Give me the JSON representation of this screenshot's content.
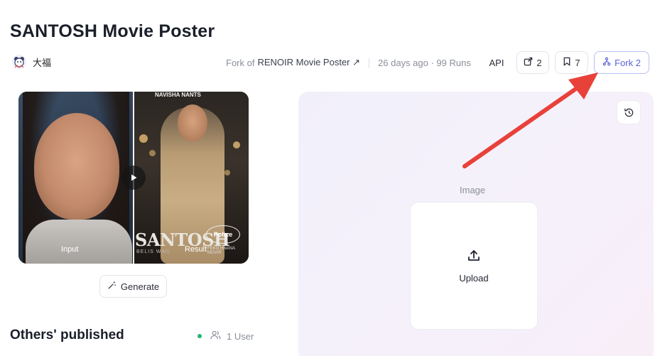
{
  "header": {
    "title": "SANTOSH Movie Poster",
    "author": "大福",
    "fork_of_prefix": "Fork of",
    "fork_of_name": "RENOIR Movie Poster ↗",
    "stats": "26 days ago · 99 Runs",
    "api_label": "API",
    "share_count": "2",
    "bookmark_count": "7",
    "fork_label": "Fork 2"
  },
  "preview": {
    "input_label": "Input",
    "result_label": "Result",
    "poster_top": "NAVISHA NANTS",
    "poster_title": "SANTOSH",
    "poster_badge": "Police",
    "poster_credit": "FEKO HNANA MOVIR",
    "poster_subtitle": "BELIS WAIL",
    "generate_label": "Generate"
  },
  "others": {
    "title": "Others' published",
    "users_label": "1 User"
  },
  "panel": {
    "image_label": "Image",
    "upload_label": "Upload"
  },
  "colors": {
    "accent": "#5a63d6",
    "annotation": "#e8413a",
    "online": "#22b573"
  }
}
